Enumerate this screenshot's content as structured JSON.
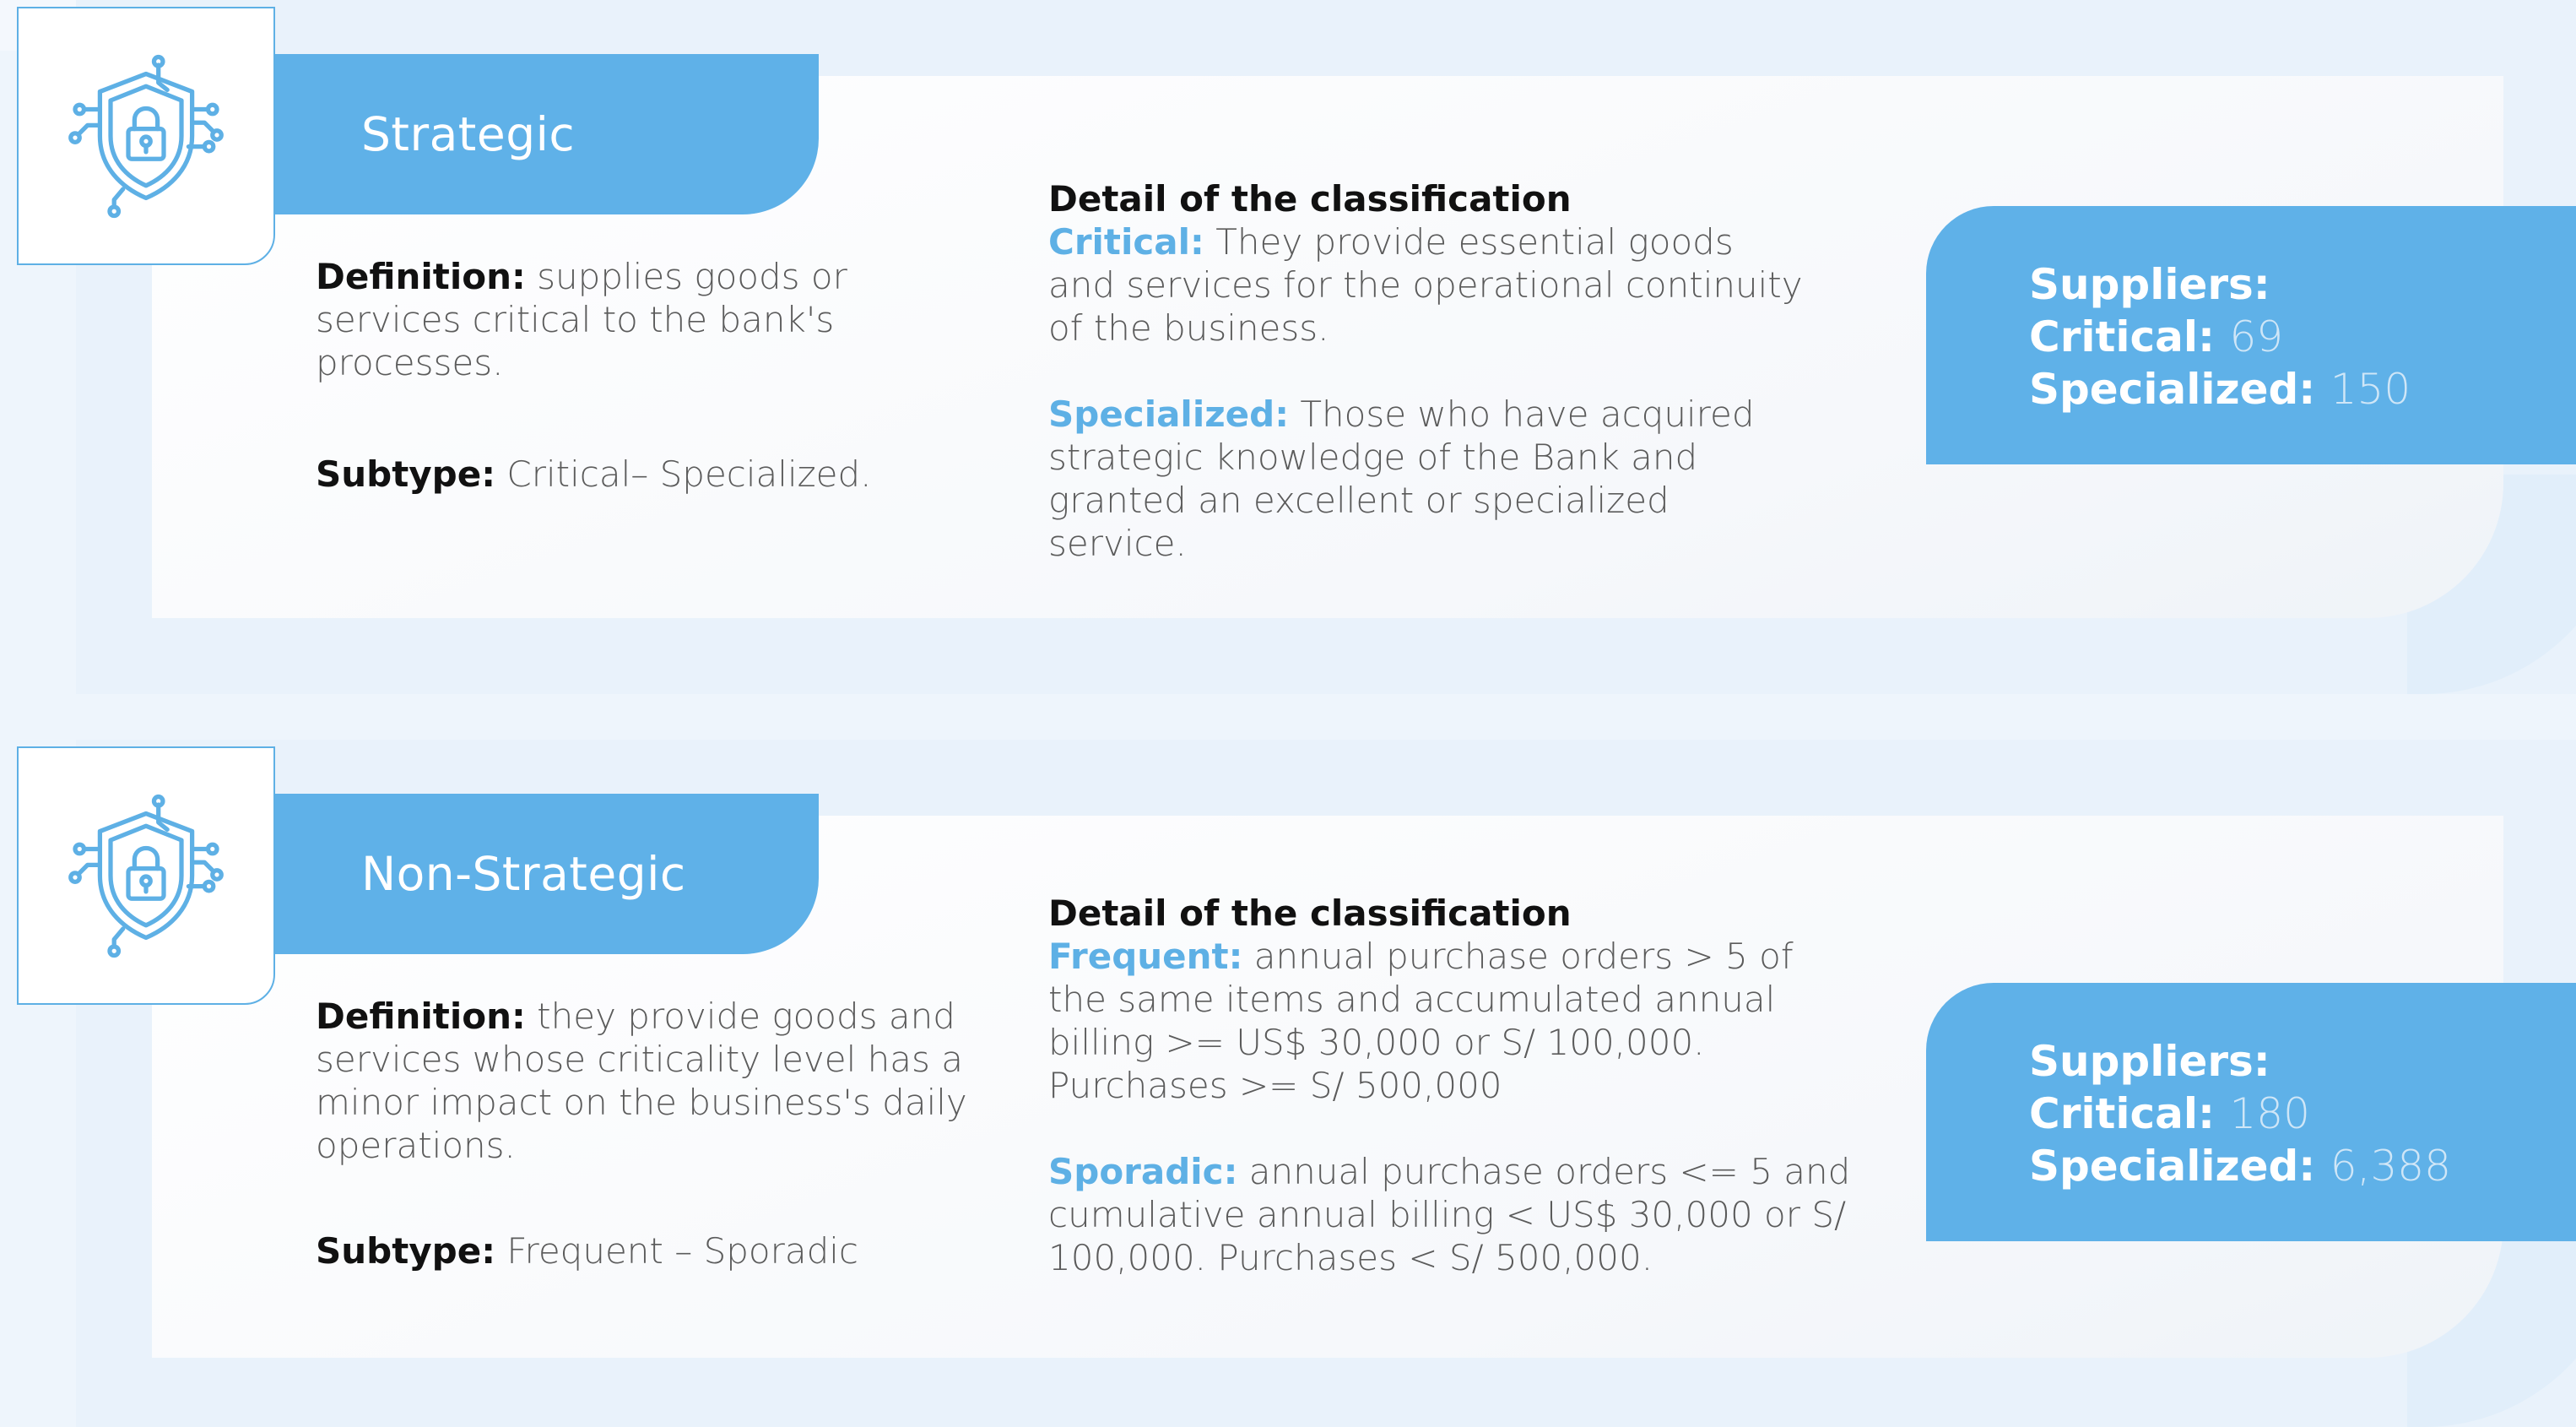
{
  "colors": {
    "accent": "#5fb1e8",
    "label_blue": "#5eb0e5",
    "text_dark": "#111111",
    "text_body": "#5b5b5b",
    "background": "#eef5fc"
  },
  "sections": [
    {
      "icon": "shield-lock-circuit-icon",
      "title": "Strategic",
      "definition_label": "Definition:",
      "definition_text": "supplies goods or services critical to the bank's processes.",
      "subtype_label": "Subtype:",
      "subtype_text": "Critical– Specialized.",
      "detail_title": "Detail of the classification",
      "detail_items": [
        {
          "label": "Critical:",
          "text": "They provide essential goods and services for the operational continuity of the business."
        },
        {
          "label": "Specialized:",
          "text": "Those who have acquired strategic knowledge of the Bank and granted an excellent or specialized service."
        }
      ],
      "suppliers_label": "Suppliers:",
      "suppliers_rows": [
        {
          "label": "Critical:",
          "value": "69"
        },
        {
          "label": "Specialized:",
          "value": "150"
        }
      ]
    },
    {
      "icon": "shield-lock-circuit-icon",
      "title": "Non-Strategic",
      "definition_label": "Definition:",
      "definition_text": "they provide goods and services whose criticality level has a minor impact on the business's daily operations.",
      "subtype_label": "Subtype:",
      "subtype_text": "Frequent – Sporadic",
      "detail_title": "Detail of the classification",
      "detail_items": [
        {
          "label": "Frequent:",
          "text": "annual purchase orders > 5 of the same items and accumulated annual billing >= US$ 30,000 or S/ 100,000. Purchases >= S/ 500,000"
        },
        {
          "label": "Sporadic:",
          "text": "annual purchase orders <= 5 and cumulative annual billing < US$ 30,000 or S/ 100,000. Purchases < S/ 500,000."
        }
      ],
      "suppliers_label": "Suppliers:",
      "suppliers_rows": [
        {
          "label": "Critical:",
          "value": "180"
        },
        {
          "label": "Specialized:",
          "value": "6,388"
        }
      ]
    }
  ]
}
